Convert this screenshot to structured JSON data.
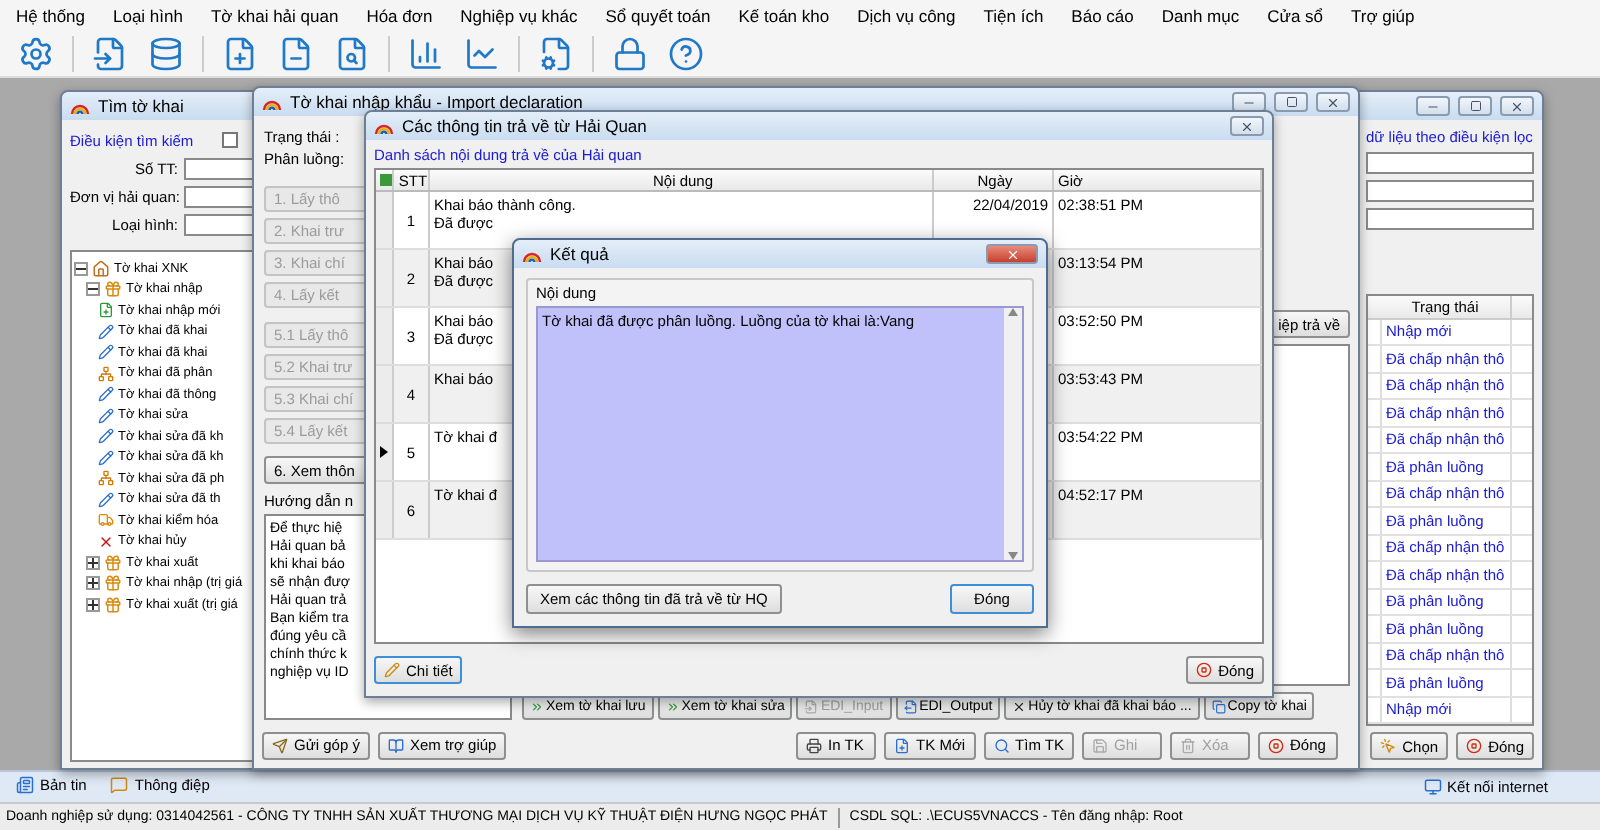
{
  "menu": [
    "Hệ thống",
    "Loại hình",
    "Tờ khai hải quan",
    "Hóa đơn",
    "Nghiệp vụ khác",
    "Sổ quyết toán",
    "Kế toán kho",
    "Dịch vụ công",
    "Tiện ích",
    "Báo cáo",
    "Danh mục",
    "Cửa sổ",
    "Trợ giúp"
  ],
  "window_search": {
    "title": "Tìm tờ khai",
    "criteria_label": "Điều kiện tìm kiếm",
    "criteria_checkbox": {
      "checked": false
    },
    "fields": [
      {
        "label": "Số TT:"
      },
      {
        "label": "Đơn vị hải quan:"
      },
      {
        "label": "Loại hình:"
      }
    ],
    "tree": [
      {
        "label": "Tờ khai XNK",
        "expanded": true,
        "children": [
          {
            "label": "Tờ khai nhập",
            "expanded": true,
            "children": [
              {
                "label": "Tờ khai nhập mới"
              },
              {
                "label": "Tờ khai đã khai"
              },
              {
                "label": "Tờ khai đã khai"
              },
              {
                "label": "Tờ khai đã phân"
              },
              {
                "label": "Tờ khai đã thông"
              },
              {
                "label": "Tờ khai sửa"
              },
              {
                "label": "Tờ khai sửa đã kh"
              },
              {
                "label": "Tờ khai sửa đã kh"
              },
              {
                "label": "Tờ khai sửa đã ph"
              },
              {
                "label": "Tờ khai sửa đã th"
              },
              {
                "label": "Tờ khai kiểm hóa"
              },
              {
                "label": "Tờ khai hủy"
              }
            ]
          },
          {
            "label": "Tờ khai xuất",
            "expanded": false
          },
          {
            "label": "Tờ khai nhập (trị giá",
            "expanded": false
          },
          {
            "label": "Tờ khai xuất (trị giá",
            "expanded": false
          }
        ]
      }
    ],
    "filter_label": "dữ liệu theo điều kiện lọc",
    "status_column": "Trạng thái",
    "status_rows": [
      "Nhập mới",
      "Đã chấp nhận thô",
      "Đã chấp nhận thô",
      "Đã chấp nhận thô",
      "Đã chấp nhận thô",
      "Đã phân luồng",
      "Đã chấp nhận thô",
      "Đã phân luồng",
      "Đã chấp nhận thô",
      "Đã chấp nhận thô",
      "Đã phân luồng",
      "Đã phân luồng",
      "Đã chấp nhận thô",
      "Đã phân luồng",
      "Nhập mới"
    ],
    "buttons": [
      "Chọn",
      "Đóng"
    ]
  },
  "window_declaration": {
    "title": "Tờ khai nhập khẩu - Import declaration",
    "status_label": "Trạng thái :",
    "channel_label": "Phân luồng:",
    "steps": [
      "1. Lấy thô",
      "2. Khai trư",
      "3. Khai chí",
      "4. Lấy kết",
      "5.1 Lấy thô",
      "5.2 Khai trư",
      "5.3 Khai chí",
      "5.4 Lấy kết",
      "6. Xem thôn"
    ],
    "guide_label": "Hướng dẫn n",
    "guide_lines": [
      "Để thực hiệ",
      "Hải quan bả",
      "khi khai báo",
      "sẽ nhận đượ",
      "Hải quan trả",
      "Bạn kiểm tra",
      "đúng yêu cầ",
      "chính thức k",
      "nghiệp vụ ID"
    ],
    "message_button": "iệp trả về",
    "actions": [
      {
        "label": "Xem tờ khai lưu",
        "disabled": false
      },
      {
        "label": "Xem tờ khai sửa",
        "disabled": false
      },
      {
        "label": "EDI_Input",
        "disabled": true
      },
      {
        "label": "EDI_Output",
        "disabled": false
      },
      {
        "label": "Hủy tờ khai đã khai báo ...",
        "disabled": false
      },
      {
        "label": "Copy tờ khai",
        "disabled": false
      }
    ],
    "footer_left": [
      "Gửi góp ý",
      "Xem trợ giúp"
    ],
    "footer_right": [
      {
        "label": "In TK",
        "disabled": false
      },
      {
        "label": "TK Mới",
        "disabled": false
      },
      {
        "label": "Tìm TK",
        "disabled": false
      },
      {
        "label": "Ghi",
        "disabled": true
      },
      {
        "label": "Xóa",
        "disabled": true
      },
      {
        "label": "Đóng",
        "disabled": false
      }
    ]
  },
  "window_responses": {
    "title": "Các thông tin trả về từ Hải Quan",
    "list_label": "Danh sách nội dung trả về của Hải quan",
    "columns": [
      "STT",
      "Nội dung",
      "Ngày",
      "Giờ"
    ],
    "rows": [
      {
        "stt": "1",
        "content": [
          "Khai báo thành công.",
          "Đã được"
        ],
        "date": "22/04/2019",
        "time": "02:38:51 PM",
        "selected": false
      },
      {
        "stt": "2",
        "content": [
          "Khai báo",
          "Đã được"
        ],
        "time": "03:13:54 PM",
        "selected": false
      },
      {
        "stt": "3",
        "content": [
          "Khai báo",
          "Đã được"
        ],
        "time": "03:52:50 PM",
        "selected": false
      },
      {
        "stt": "4",
        "content": [
          "Khai báo"
        ],
        "time": "03:53:43 PM",
        "selected": false
      },
      {
        "stt": "5",
        "content": [
          "Tờ khai đ"
        ],
        "time": "03:54:22 PM",
        "selected": true
      },
      {
        "stt": "6",
        "content": [
          "Tờ khai đ"
        ],
        "time": "04:52:17 PM",
        "selected": false
      }
    ],
    "buttons": [
      "Chi tiết",
      "Đóng"
    ]
  },
  "dialog_result": {
    "title": "Kết quả",
    "group_label": "Nội dung",
    "message": "Tờ khai đã được phân luồng. Luồng của tờ khai là:Vang",
    "buttons": [
      "Xem các thông tin đã trả về từ HQ",
      "Đóng"
    ]
  },
  "taskbar": {
    "left": [
      "Bản tin",
      "Thông điệp"
    ],
    "right": "Kết nối internet"
  },
  "status_bar": [
    "Doanh nghiệp sử dụng: 0314042561 - CÔNG TY TNHH SẢN XUẤT THƯƠNG MẠI DỊCH VỤ KỸ THUẬT ĐIỆN HƯNG NGỌC PHÁT",
    "CSDL SQL: .\\ECUS5VNACCS - Tên đăng nhập: Root"
  ]
}
